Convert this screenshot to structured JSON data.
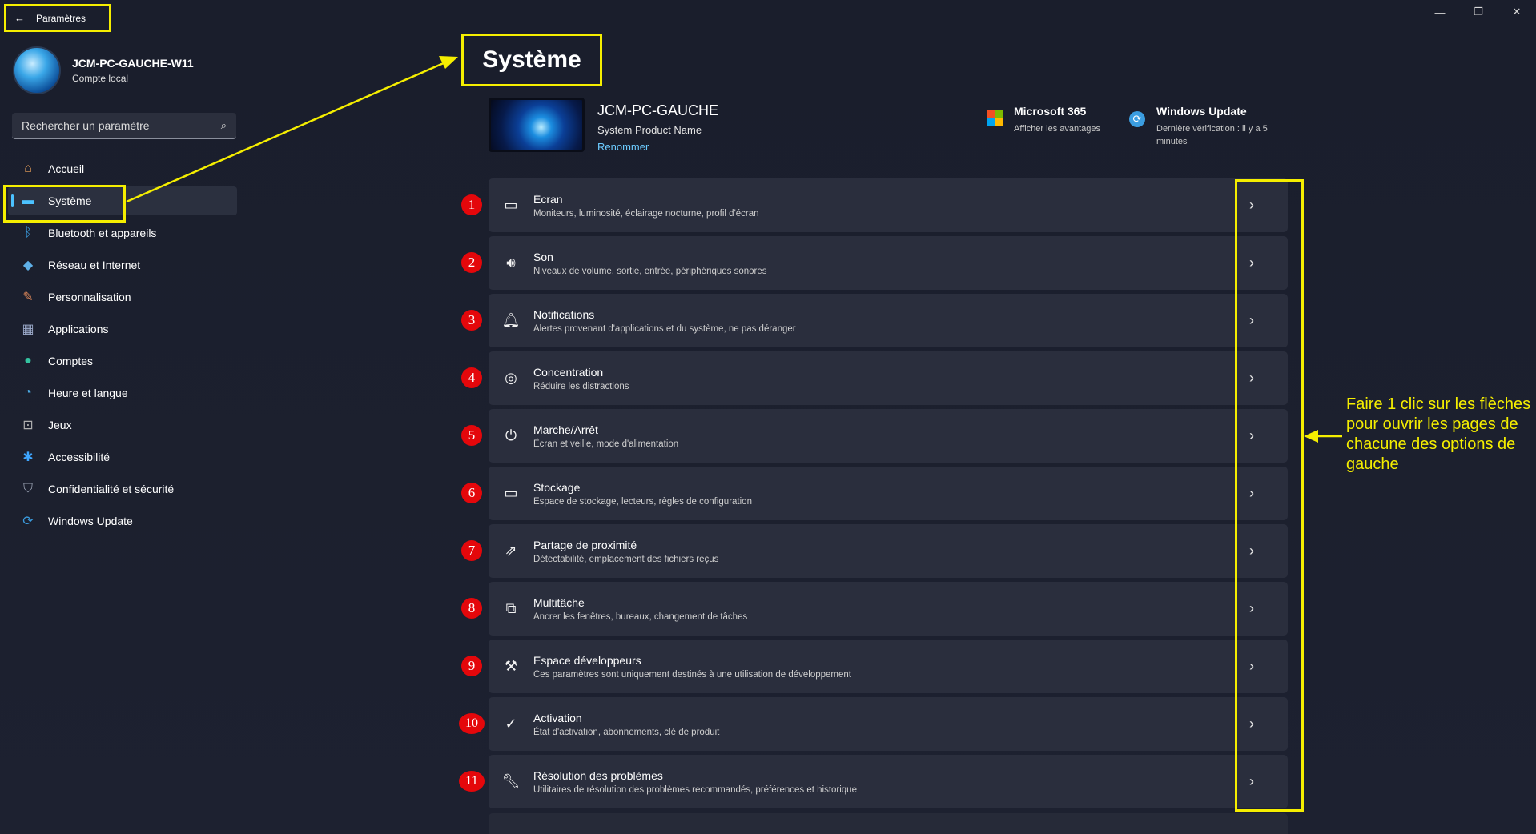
{
  "window": {
    "title": "Paramètres",
    "controls": [
      "—",
      "❐",
      "✕"
    ]
  },
  "account": {
    "name": "JCM-PC-GAUCHE-W11",
    "type": "Compte local"
  },
  "search": {
    "placeholder": "Rechercher un paramètre"
  },
  "sidebar": {
    "items": [
      {
        "label": "Accueil",
        "icon": "home-icon",
        "glyph": "⌂",
        "color": "#f0a35a"
      },
      {
        "label": "Système",
        "icon": "system-icon",
        "glyph": "▬",
        "color": "#4cc2ff"
      },
      {
        "label": "Bluetooth et appareils",
        "icon": "bluetooth-icon",
        "glyph": "ᛒ",
        "color": "#3b9de0"
      },
      {
        "label": "Réseau et Internet",
        "icon": "network-icon",
        "glyph": "◆",
        "color": "#5fb0e8"
      },
      {
        "label": "Personnalisation",
        "icon": "brush-icon",
        "glyph": "✎",
        "color": "#e38a5a"
      },
      {
        "label": "Applications",
        "icon": "apps-icon",
        "glyph": "▦",
        "color": "#9aa8c8"
      },
      {
        "label": "Comptes",
        "icon": "accounts-icon",
        "glyph": "●",
        "color": "#34c3a0"
      },
      {
        "label": "Heure et langue",
        "icon": "globe-clock-icon",
        "glyph": "◔",
        "color": "#4aa8e0"
      },
      {
        "label": "Jeux",
        "icon": "gamepad-icon",
        "glyph": "⊡",
        "color": "#b0b0b0"
      },
      {
        "label": "Accessibilité",
        "icon": "accessibility-icon",
        "glyph": "✱",
        "color": "#3ea6ff"
      },
      {
        "label": "Confidentialité et sécurité",
        "icon": "shield-icon",
        "glyph": "⛉",
        "color": "#9aa2b2"
      },
      {
        "label": "Windows Update",
        "icon": "update-icon",
        "glyph": "⟳",
        "color": "#3b9de0"
      }
    ]
  },
  "page": {
    "title": "Système"
  },
  "device": {
    "name": "JCM-PC-GAUCHE",
    "model": "System Product Name",
    "rename": "Renommer"
  },
  "header_cards": {
    "ms365": {
      "title": "Microsoft 365",
      "sub": "Afficher les avantages"
    },
    "update": {
      "title": "Windows Update",
      "sub": "Dernière vérification : il y a 5 minutes"
    }
  },
  "settings": [
    {
      "num": "1",
      "title": "Écran",
      "desc": "Moniteurs, luminosité, éclairage nocturne, profil d'écran",
      "icon": "display-icon",
      "glyph": "▭"
    },
    {
      "num": "2",
      "title": "Son",
      "desc": "Niveaux de volume, sortie, entrée, périphériques sonores",
      "icon": "speaker-icon",
      "glyph": "🔊︎"
    },
    {
      "num": "3",
      "title": "Notifications",
      "desc": "Alertes provenant d'applications et du système, ne pas déranger",
      "icon": "bell-icon",
      "glyph": "🔔︎"
    },
    {
      "num": "4",
      "title": "Concentration",
      "desc": "Réduire les distractions",
      "icon": "focus-icon",
      "glyph": "◎"
    },
    {
      "num": "5",
      "title": "Marche/Arrêt",
      "desc": "Écran et veille, mode d'alimentation",
      "icon": "power-icon",
      "glyph": "⏻"
    },
    {
      "num": "6",
      "title": "Stockage",
      "desc": "Espace de stockage, lecteurs, règles de configuration",
      "icon": "storage-icon",
      "glyph": "▭"
    },
    {
      "num": "7",
      "title": "Partage de proximité",
      "desc": "Détectabilité, emplacement des fichiers reçus",
      "icon": "share-icon",
      "glyph": "⇗"
    },
    {
      "num": "8",
      "title": "Multitâche",
      "desc": "Ancrer les fenêtres, bureaux, changement de tâches",
      "icon": "multitask-icon",
      "glyph": "⧉"
    },
    {
      "num": "9",
      "title": "Espace développeurs",
      "desc": "Ces paramètres sont uniquement destinés à une utilisation de développement",
      "icon": "developer-tools-icon",
      "glyph": "⚒"
    },
    {
      "num": "10",
      "title": "Activation",
      "desc": "État d'activation, abonnements, clé de produit",
      "icon": "check-circle-icon",
      "glyph": "✓"
    },
    {
      "num": "11",
      "title": "Résolution des problèmes",
      "desc": "Utilitaires de résolution des problèmes recommandés, préférences et historique",
      "icon": "wrench-icon",
      "glyph": "🔧︎"
    }
  ],
  "annotation": {
    "text": "Faire 1 clic sur les flèches pour ouvrir les pages de chacune des options de gauche"
  },
  "colors": {
    "highlight": "#f5ee00",
    "accent": "#4cc2ff",
    "badge": "#e4070b"
  }
}
